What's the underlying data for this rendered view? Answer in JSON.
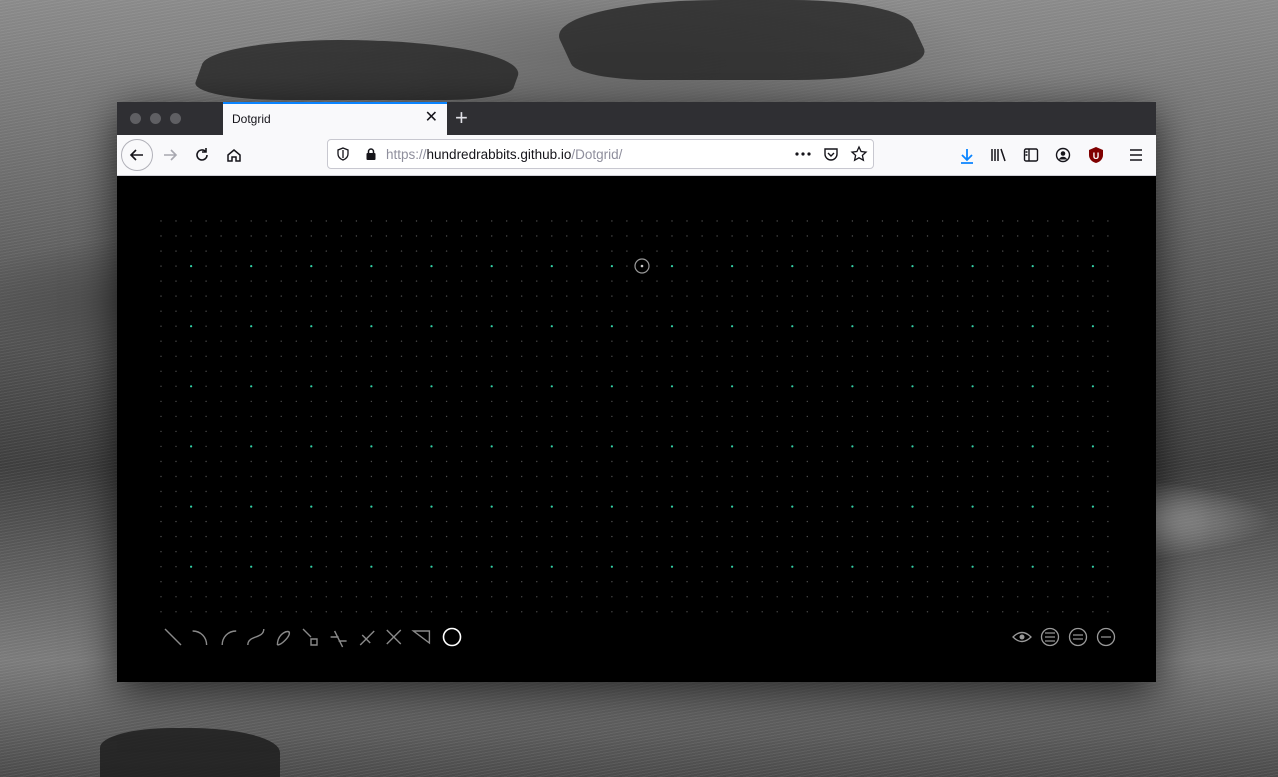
{
  "browser": {
    "tab": {
      "title": "Dotgrid"
    },
    "url": {
      "scheme": "https://",
      "host": "hundredrabbits.github.io",
      "path": "/Dotgrid/"
    },
    "icons": [
      "back-icon",
      "forward-icon",
      "reload-icon",
      "home-icon",
      "shield-icon",
      "lock-icon",
      "more-icon",
      "pocket-icon",
      "star-icon",
      "download-icon",
      "library-icon",
      "sidebar-icon",
      "account-icon",
      "ublock-icon",
      "menu-icon"
    ]
  },
  "app": {
    "name": "Dotgrid",
    "grid_color": "#34d1a8",
    "dim_dot_color": "#3a3a3a",
    "tools": [
      "line",
      "arc-clockwise",
      "arc-counterclockwise",
      "bezier",
      "close",
      "linecap",
      "linejoin",
      "thickness",
      "mirror",
      "fill",
      "color"
    ],
    "settings": [
      "preview-eye",
      "style-1",
      "style-2",
      "style-3"
    ]
  }
}
